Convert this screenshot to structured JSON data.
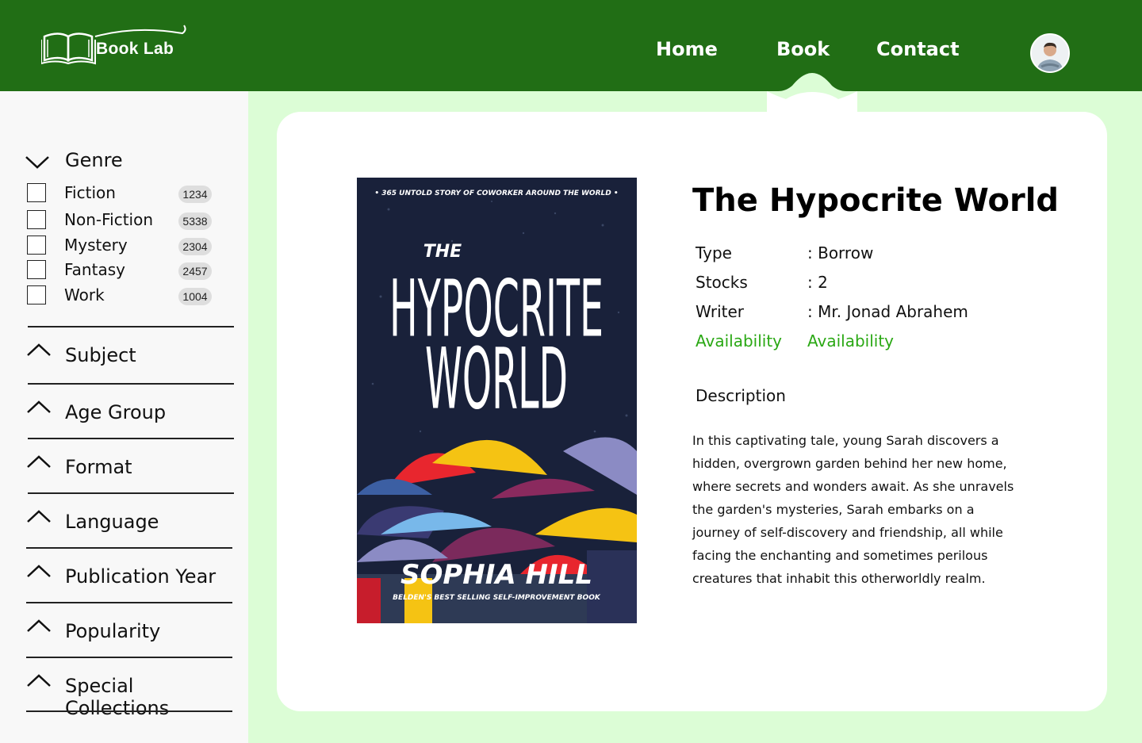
{
  "brand": {
    "name": "Book Lab"
  },
  "nav": {
    "items": [
      {
        "label": "Home"
      },
      {
        "label": "Book"
      },
      {
        "label": "Contact"
      }
    ],
    "active": "Book"
  },
  "sidebar": {
    "genre": {
      "title": "Genre",
      "items": [
        {
          "label": "Fiction",
          "count": "1234"
        },
        {
          "label": "Non-Fiction",
          "count": "5338"
        },
        {
          "label": "Mystery",
          "count": "2304"
        },
        {
          "label": "Fantasy",
          "count": "2457"
        },
        {
          "label": "Work",
          "count": "1004"
        }
      ]
    },
    "filters": [
      {
        "label": "Subject"
      },
      {
        "label": "Age Group"
      },
      {
        "label": "Format"
      },
      {
        "label": "Language"
      },
      {
        "label": "Publication Year"
      },
      {
        "label": "Popularity"
      },
      {
        "label": "Special Collections"
      }
    ]
  },
  "book": {
    "title": "The Hypocrite World",
    "cover": {
      "tagline": "• 365 UNTOLD STORY OF COWORKER AROUND THE WORLD •",
      "title_small": "THE",
      "title_line1": "HYPOCRITE",
      "title_line2": "WORLD",
      "author": "SOPHIA HILL",
      "subtitle": "BELDEN'S BEST SELLING SELF-IMPROVEMENT BOOK"
    },
    "meta": [
      {
        "label": "Type",
        "value": ": Borrow"
      },
      {
        "label": "Stocks",
        "value": ": 2"
      },
      {
        "label": "Writer",
        "value": ": Mr. Jonad Abrahem"
      },
      {
        "label": "Availability",
        "value": "Availability"
      }
    ],
    "description_heading": "Description",
    "description": "In this captivating tale, young Sarah discovers a hidden, overgrown garden behind her new home, where secrets and wonders await. As she unravels the garden's mysteries, Sarah embarks on a journey of self-discovery and friendship, all while facing the enchanting and sometimes perilous creatures that inhabit this otherworldly realm."
  },
  "colors": {
    "header": "#216e15",
    "background": "#dcfdd6",
    "availability": "#2aa814"
  }
}
